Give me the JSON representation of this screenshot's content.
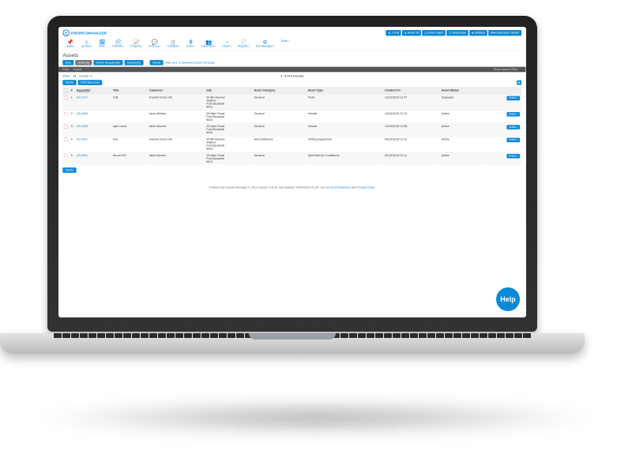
{
  "brand": "EWORKSMANAGER",
  "header_badges": [
    {
      "name": "tsm-badge",
      "icon": "▲",
      "label": "T.S.M"
    },
    {
      "name": "refer-badge",
      "icon": "★",
      "label": "Refer Us"
    },
    {
      "name": "booking-badge",
      "icon": "◷",
      "label": "Book a sync"
    },
    {
      "name": "help-badge",
      "icon": "ⓘ",
      "label": "Helpcentre"
    },
    {
      "name": "settings-badge",
      "icon": "✿",
      "label": "Settings"
    },
    {
      "name": "welcome-badge",
      "icon": "",
      "label": "Welcome back, farmer"
    }
  ],
  "nav": [
    {
      "name": "nav-leads",
      "icon": "📌",
      "label": "Leads"
    },
    {
      "name": "nav-quotes",
      "icon": "⚠",
      "label": "Quotes"
    },
    {
      "name": "nav-jobs",
      "icon": "🗓",
      "label": "Jobs"
    },
    {
      "name": "nav-planner",
      "icon": "🛠",
      "label": "Planner"
    },
    {
      "name": "nav-projects",
      "icon": "📈",
      "label": "Projects"
    },
    {
      "name": "nav-finance",
      "icon": "💬",
      "label": "Finance"
    },
    {
      "name": "nav-contacts",
      "icon": "🛒",
      "label": "Contacts"
    },
    {
      "name": "nav-items",
      "icon": "🖩",
      "label": "Items"
    },
    {
      "name": "nav-expenses",
      "icon": "👥",
      "label": "Expenses"
    },
    {
      "name": "nav-users",
      "icon": "◔",
      "label": "Users"
    },
    {
      "name": "nav-reports",
      "icon": "📄",
      "label": "Reports"
    },
    {
      "name": "nav-filemanager",
      "icon": "⚙",
      "label": "File Manager"
    },
    {
      "name": "nav-tools",
      "icon": "",
      "label": "Tools"
    }
  ],
  "page_title": "Assets",
  "toolbar": {
    "new_label": "New",
    "active_label": "Active(5)",
    "action_required_label": "Action Required(0)",
    "inactive_label": "Inactive(0)",
    "import_label": "Import",
    "template_link": "Click here to download import template"
  },
  "bar": {
    "print_label": "Print",
    "export_label": "Export",
    "search_label": "Show Search Filter"
  },
  "subbar": {
    "show_label": "Show",
    "page_size": "All",
    "records_label": "records",
    "refresh_icon": "⟳",
    "range_text": "1 - 5 of 5 records"
  },
  "action_row": {
    "delete_label": "Delete",
    "print_barcodes_label": "Print Barcodes"
  },
  "columns": {
    "num": "#",
    "asset_ref": "Asset Ref",
    "title": "Title",
    "customer": "Customer",
    "site": "Site",
    "category": "Asset Category",
    "type": "Asset Type",
    "created": "Created On",
    "status": "Asset Status"
  },
  "rows": [
    {
      "n": "1.",
      "ref": "AS-0147",
      "title": "Drill",
      "customer": "Eworks Demo SA",
      "site": "64 8th Avenue\nWalmer\nPort Elizabeth\n6001",
      "category": "General",
      "type": "Tools",
      "created": "12/12/2018 11:07",
      "status": "Deployed"
    },
    {
      "n": "2.",
      "ref": "AS-0059",
      "title": "",
      "customer": "taine Kitchen",
      "site": "25 Main Road\nPort Elizabeth\n6001",
      "category": "General",
      "type": "Vehicle",
      "created": "12/10/2018 12:12",
      "status": "Active"
    },
    {
      "n": "3.",
      "ref": "AS-0055",
      "title": "opel corsa",
      "customer": "taine Kitchen",
      "site": "25 Main Road\nPort Elizabeth\n6001",
      "category": "General",
      "type": "Vehicle",
      "created": "12/10/2018 11:55",
      "status": "Active"
    },
    {
      "n": "4.",
      "ref": "AS-0287",
      "title": "test",
      "customer": "Eworks Demo SA",
      "site": "64 8th Avenue\nWalmer\nPort Elizabeth\n6001",
      "category": "Airconditioners",
      "type": "Chilling Equipment",
      "created": "09/10/2018 11:12",
      "status": "Active"
    },
    {
      "n": "5.",
      "ref": "AS-0091",
      "title": "Aircon123",
      "customer": "taine Kitchen",
      "site": "25 Main Road\nPort Elizabeth\n6001",
      "category": "General",
      "type": "Split Wall Air Conditioner",
      "created": "20/10/2018 11:11",
      "status": "Active"
    }
  ],
  "row_action_label": "Action",
  "below_delete": "Delete",
  "footer": {
    "text_a": "Powered by Eworks Manager © 2019 version: 6.8.90, last updated: 04/02/2019 21:05. Our ",
    "link1": "Terms Of Business",
    "text_b": " and ",
    "link2": "Privacy Policy"
  },
  "help_label": "Help"
}
